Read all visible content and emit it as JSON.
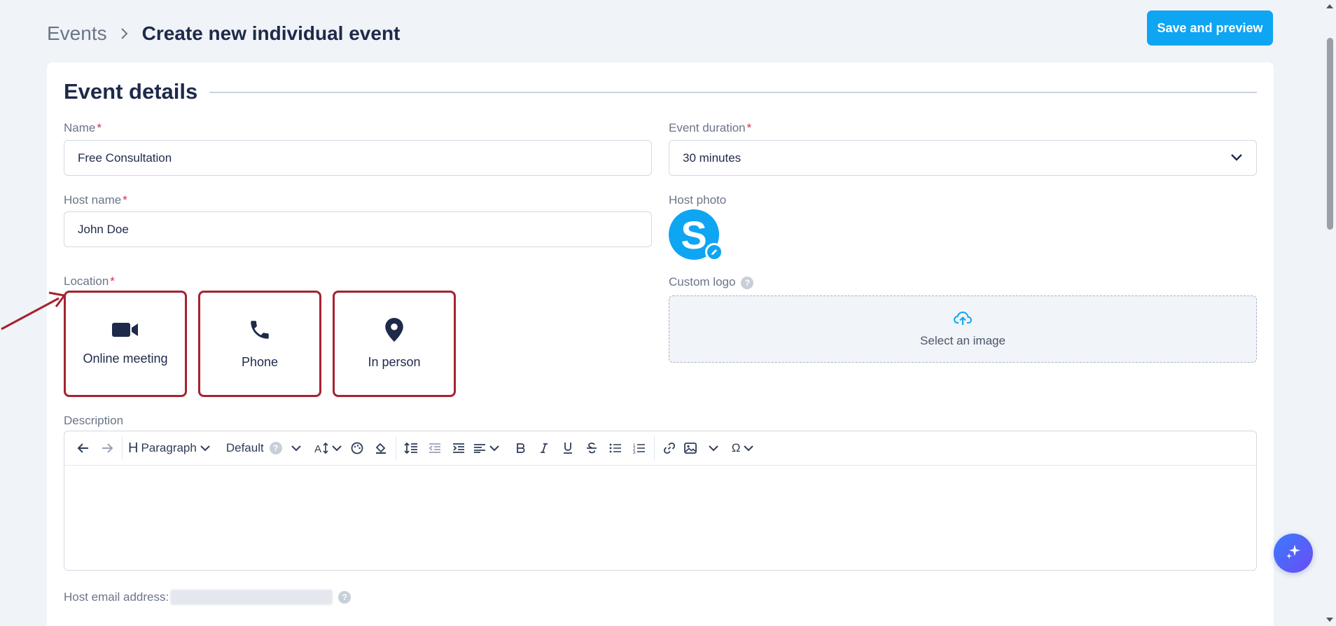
{
  "breadcrumb": {
    "parent": "Events",
    "current": "Create new individual event"
  },
  "header": {
    "save_label": "Save and preview"
  },
  "section": {
    "title": "Event details"
  },
  "fields": {
    "name": {
      "label": "Name",
      "required": "*",
      "value": "Free Consultation"
    },
    "duration": {
      "label": "Event duration",
      "required": "*",
      "value": "30 minutes"
    },
    "host_name": {
      "label": "Host name",
      "required": "*",
      "value": "John Doe"
    },
    "host_photo": {
      "label": "Host photo",
      "initial": "S"
    },
    "location": {
      "label": "Location",
      "required": "*",
      "options": [
        {
          "label": "Online meeting",
          "icon": "video-icon"
        },
        {
          "label": "Phone",
          "icon": "phone-icon"
        },
        {
          "label": "In person",
          "icon": "map-pin-icon"
        }
      ]
    },
    "custom_logo": {
      "label": "Custom logo",
      "help": "?",
      "dropzone_text": "Select an image"
    },
    "description": {
      "label": "Description",
      "toolbar": {
        "heading": "Paragraph",
        "font": "Default",
        "font_help": "?",
        "special_char": "Ω"
      }
    },
    "host_email": {
      "label": "Host email address:",
      "help": "?"
    }
  },
  "colors": {
    "accent": "#0ea5f3",
    "highlight_border": "#a5232f",
    "required": "#e0284d"
  }
}
